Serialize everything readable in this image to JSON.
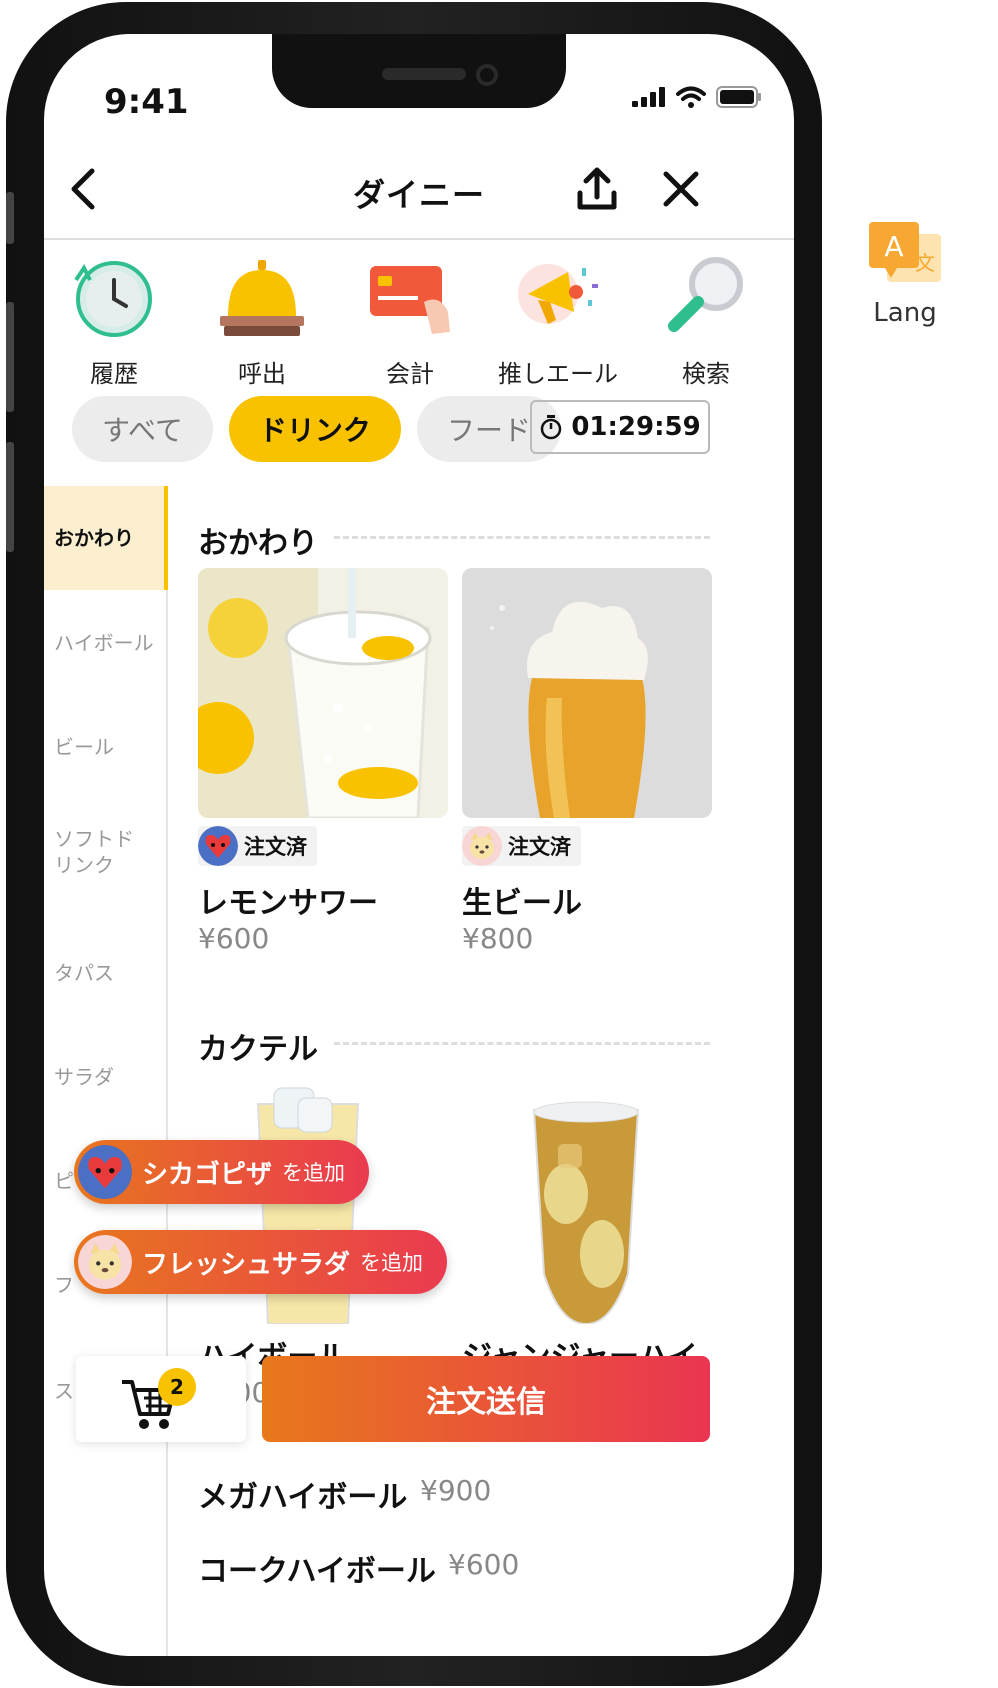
{
  "status": {
    "time": "9:41"
  },
  "header": {
    "title": "ダイニー"
  },
  "quick_actions": [
    {
      "label": "履歴",
      "icon": "clock-icon"
    },
    {
      "label": "呼出",
      "icon": "bell-icon"
    },
    {
      "label": "会計",
      "icon": "credit-card-icon"
    },
    {
      "label": "推しエール",
      "icon": "megaphone-icon"
    },
    {
      "label": "検索",
      "icon": "magnifier-icon"
    }
  ],
  "lang": {
    "label": "Lang",
    "glyph_a": "A",
    "glyph_b": "文"
  },
  "tabs": [
    {
      "label": "すべて",
      "active": false
    },
    {
      "label": "ドリンク",
      "active": true
    },
    {
      "label": "フード",
      "active": false
    }
  ],
  "timer": {
    "value": "01:29:59"
  },
  "sidebar": [
    {
      "label": "おかわり",
      "active": true
    },
    {
      "label": "ハイボール"
    },
    {
      "label": "ビール"
    },
    {
      "label": "ソフトドリンク"
    },
    {
      "label": "タパス"
    },
    {
      "label": "サラダ"
    },
    {
      "label": "ピ"
    },
    {
      "label": "フ"
    },
    {
      "label": "スィーツ"
    }
  ],
  "sections": {
    "okawari": "おかわり",
    "cocktail": "カクテル"
  },
  "items": [
    {
      "name": "レモンサワー",
      "price": "¥600",
      "ordered": "注文済"
    },
    {
      "name": "生ビール",
      "price": "¥800",
      "ordered": "注文済"
    },
    {
      "name": "ハイボール",
      "price": "¥600"
    },
    {
      "name": "ジャンジャーハイ",
      "price": ""
    },
    {
      "name": "メガハイボール",
      "price": "¥900"
    },
    {
      "name": "コークハイボール",
      "price": "¥600"
    }
  ],
  "toasts": [
    {
      "name": "シカゴピザ",
      "suffix": "を追加"
    },
    {
      "name": "フレッシュサラダ",
      "suffix": "を追加"
    }
  ],
  "cart": {
    "count": "2"
  },
  "submit": {
    "label": "注文送信"
  },
  "colors": {
    "accent": "#f8c200",
    "gradient_start": "#e8781c",
    "gradient_end": "#ea3552"
  }
}
